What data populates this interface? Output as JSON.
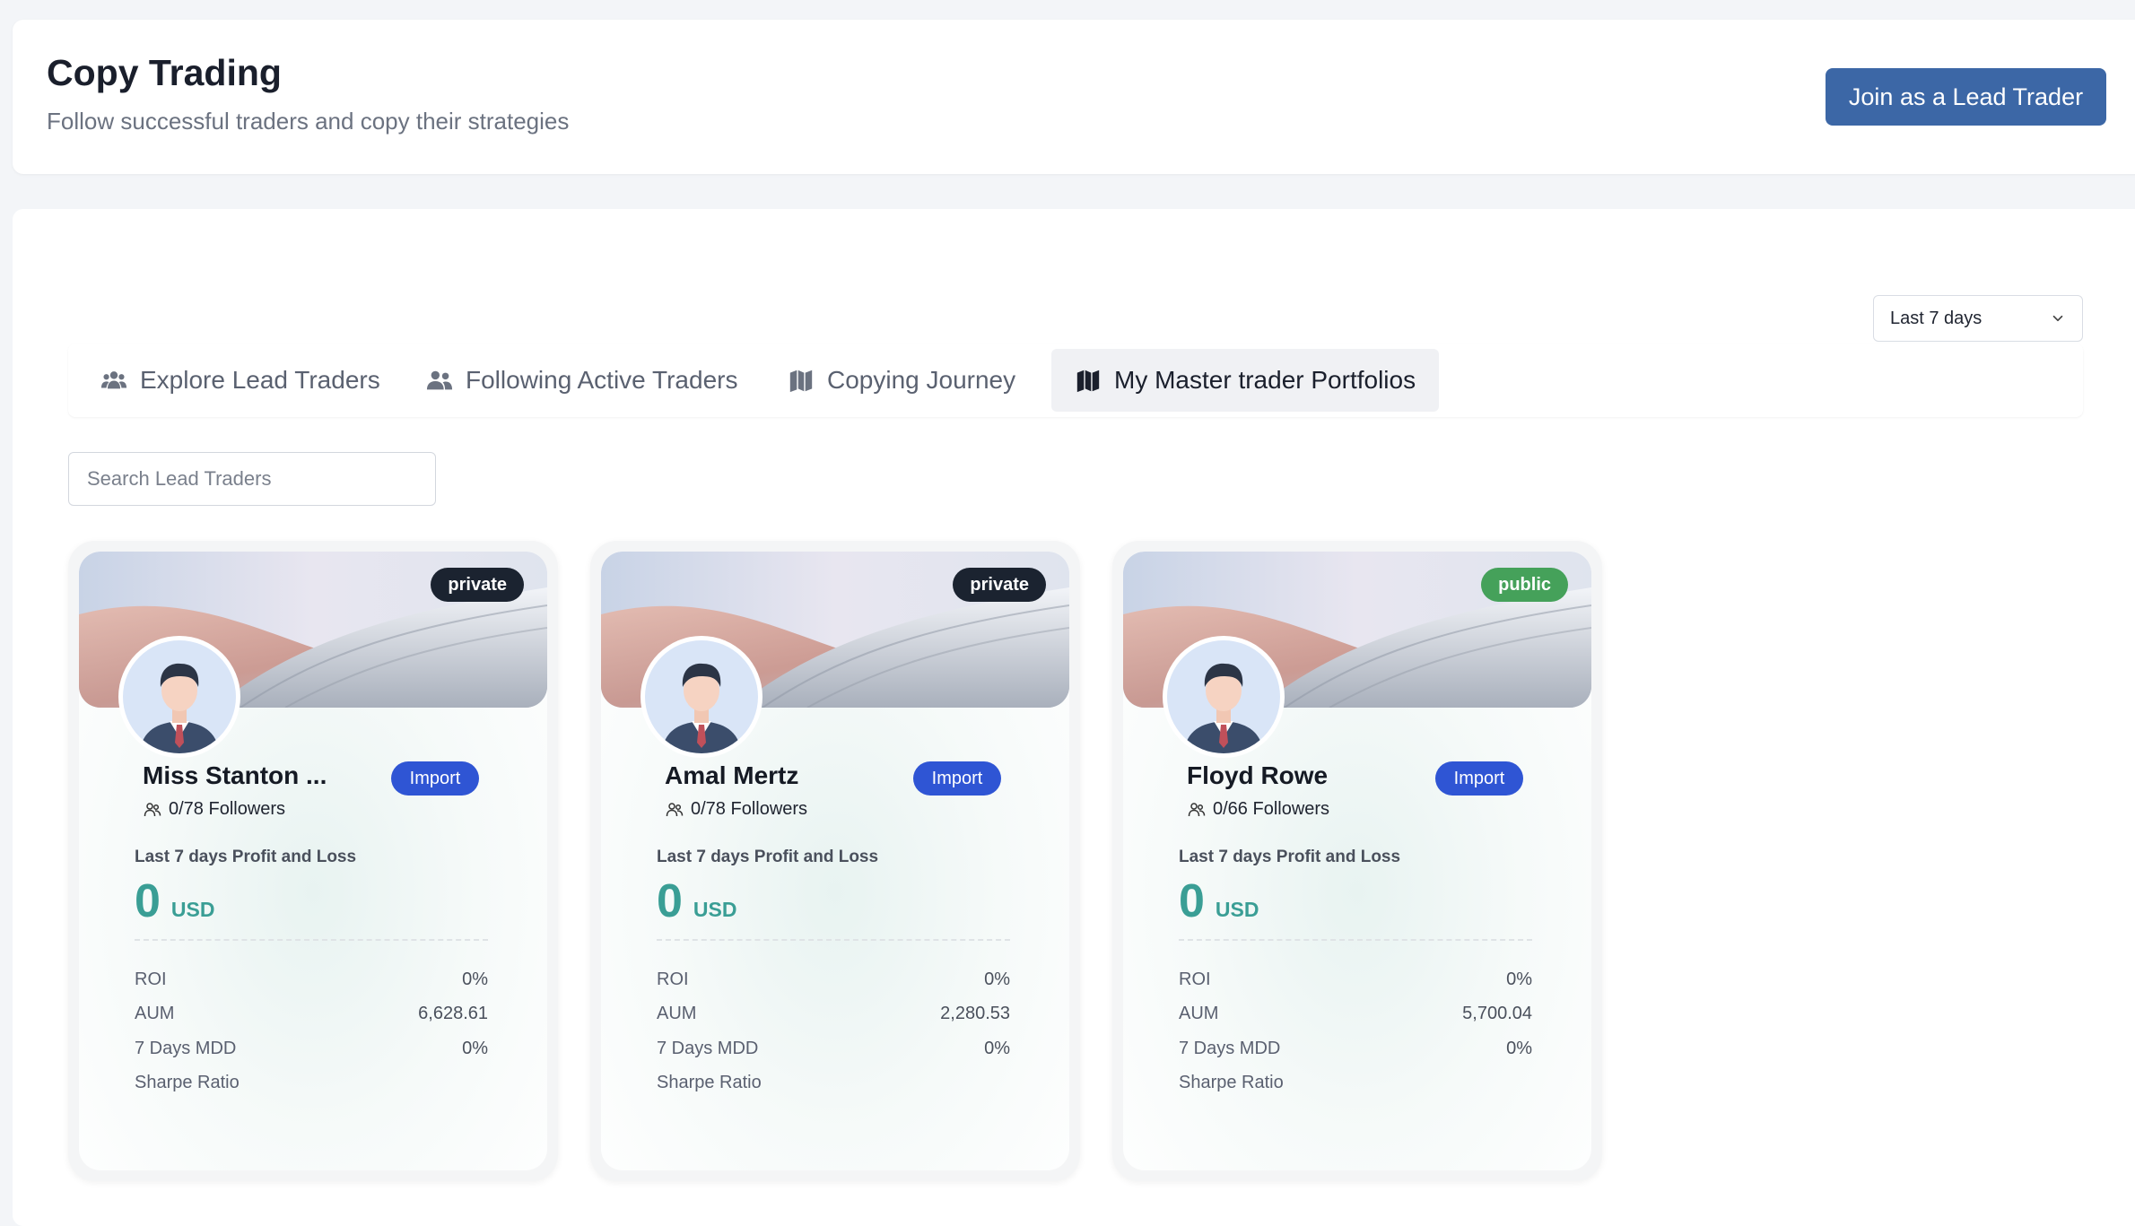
{
  "header": {
    "title": "Copy Trading",
    "subtitle": "Follow successful traders and copy their strategies",
    "join_button": "Join as a Lead Trader"
  },
  "filters": {
    "range": "Last 7 days",
    "search_placeholder": "Search Lead Traders"
  },
  "tabs": [
    {
      "label": "Explore Lead Traders",
      "icon": "users-group-icon",
      "active": false
    },
    {
      "label": "Following Active Traders",
      "icon": "user-friends-icon",
      "active": false
    },
    {
      "label": "Copying Journey",
      "icon": "map-icon",
      "active": false
    },
    {
      "label": "My Master trader Portfolios",
      "icon": "map-icon",
      "active": true
    }
  ],
  "colors": {
    "primary": "#3c67a6",
    "import": "#2f55d4",
    "profit": "#3a9e95",
    "private_badge": "#1b2330",
    "public_badge": "#45a15a"
  },
  "cards": [
    {
      "badge": "private",
      "name": "Miss Stanton ...",
      "import_label": "Import",
      "followers": "0/78 Followers",
      "pnl_label": "Last 7 days Profit and Loss",
      "pnl_value": "0",
      "pnl_unit": "USD",
      "stats": [
        {
          "label": "ROI",
          "value": "0%"
        },
        {
          "label": "AUM",
          "value": "6,628.61"
        },
        {
          "label": "7 Days MDD",
          "value": "0%"
        },
        {
          "label": "Sharpe Ratio",
          "value": ""
        }
      ]
    },
    {
      "badge": "private",
      "name": "Amal Mertz",
      "import_label": "Import",
      "followers": "0/78 Followers",
      "pnl_label": "Last 7 days Profit and Loss",
      "pnl_value": "0",
      "pnl_unit": "USD",
      "stats": [
        {
          "label": "ROI",
          "value": "0%"
        },
        {
          "label": "AUM",
          "value": "2,280.53"
        },
        {
          "label": "7 Days MDD",
          "value": "0%"
        },
        {
          "label": "Sharpe Ratio",
          "value": ""
        }
      ]
    },
    {
      "badge": "public",
      "name": "Floyd Rowe",
      "import_label": "Import",
      "followers": "0/66 Followers",
      "pnl_label": "Last 7 days Profit and Loss",
      "pnl_value": "0",
      "pnl_unit": "USD",
      "stats": [
        {
          "label": "ROI",
          "value": "0%"
        },
        {
          "label": "AUM",
          "value": "5,700.04"
        },
        {
          "label": "7 Days MDD",
          "value": "0%"
        },
        {
          "label": "Sharpe Ratio",
          "value": ""
        }
      ]
    }
  ]
}
